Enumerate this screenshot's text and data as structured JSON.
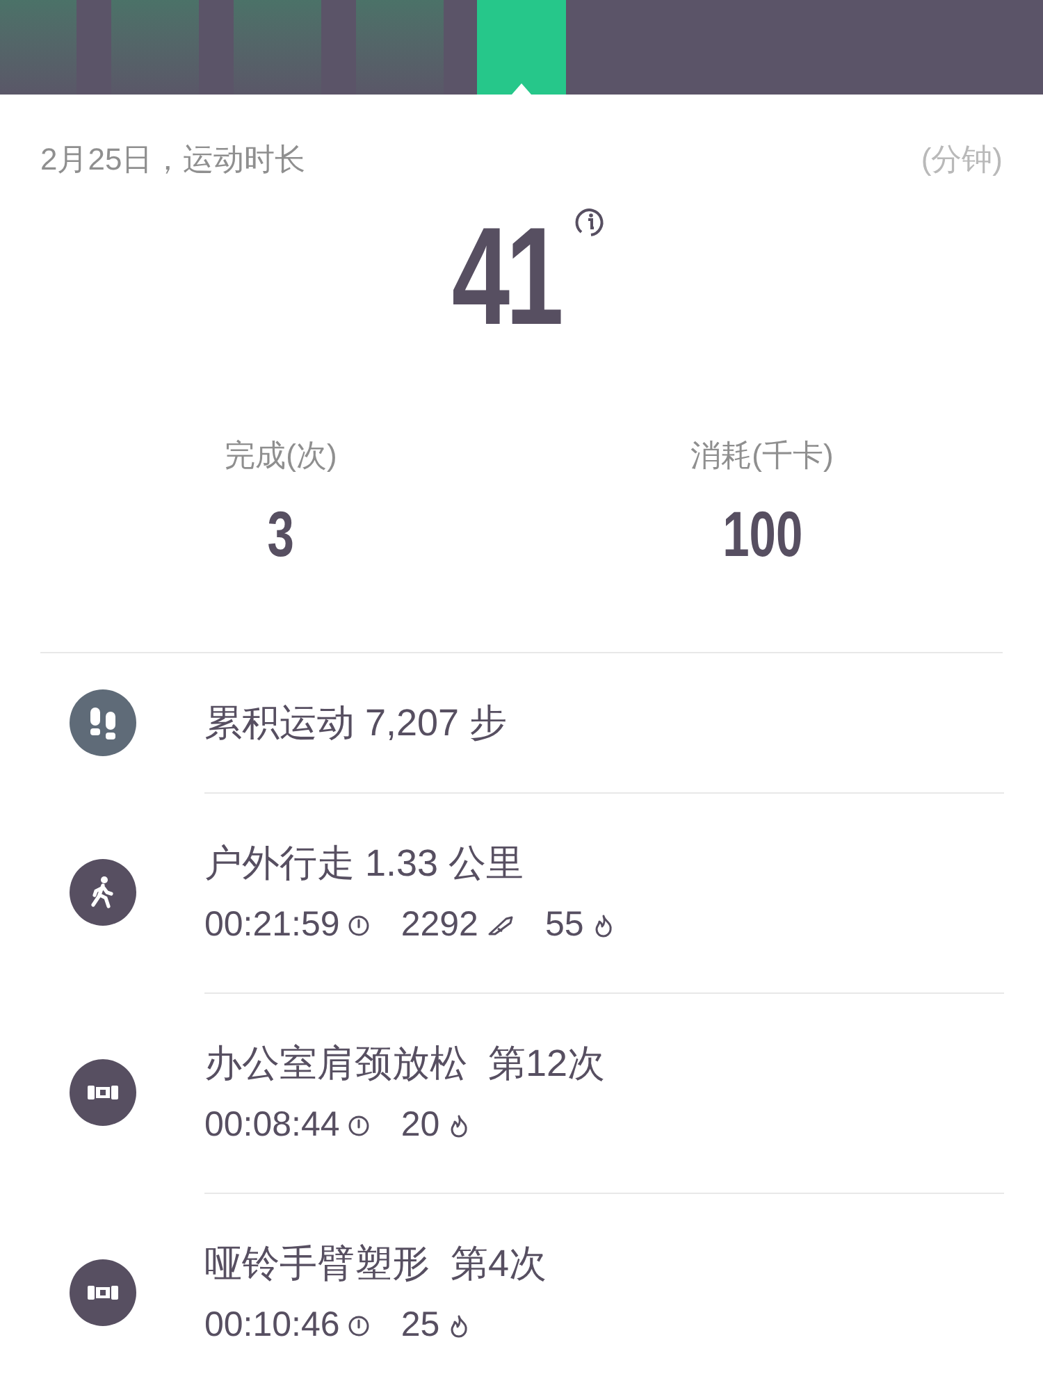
{
  "day_bars": [
    {
      "selected": false
    },
    {
      "selected": false
    },
    {
      "selected": false
    },
    {
      "selected": false
    },
    {
      "selected": true
    }
  ],
  "header": {
    "date_title": "2月25日，运动时长",
    "unit": "(分钟)"
  },
  "total": {
    "value": "41"
  },
  "stats": [
    {
      "label": "完成(次)",
      "value": "3"
    },
    {
      "label": "消耗(千卡)",
      "value": "100"
    }
  ],
  "activities": [
    {
      "kind": "steps",
      "title": "累积运动 7,207 步"
    },
    {
      "kind": "walk",
      "title": "户外行走 1.33 公里",
      "metrics": [
        {
          "kind": "time",
          "value": "00:21:59"
        },
        {
          "kind": "steps",
          "value": "2292"
        },
        {
          "kind": "calories",
          "value": "55"
        }
      ]
    },
    {
      "kind": "workout",
      "title": "办公室肩颈放松  第12次",
      "metrics": [
        {
          "kind": "time",
          "value": "00:08:44"
        },
        {
          "kind": "calories",
          "value": "20"
        }
      ]
    },
    {
      "kind": "workout",
      "title": "哑铃手臂塑形  第4次",
      "metrics": [
        {
          "kind": "time",
          "value": "00:10:46"
        },
        {
          "kind": "calories",
          "value": "25"
        }
      ]
    }
  ]
}
